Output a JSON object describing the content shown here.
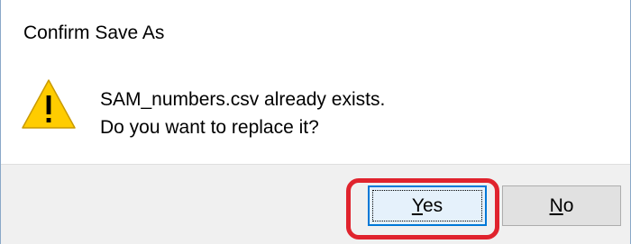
{
  "dialog": {
    "title": "Confirm Save As",
    "icon": "warning-icon",
    "message_line1": "SAM_numbers.csv already exists.",
    "message_line2": "Do you want to replace it?"
  },
  "buttons": {
    "yes": {
      "accel": "Y",
      "rest": "es",
      "focused": true
    },
    "no": {
      "accel": "N",
      "rest": "o",
      "focused": false
    }
  },
  "colors": {
    "accent_focus": "#0078d7",
    "highlight_ring": "#e0232d",
    "warning_yellow": "#ffcc00",
    "button_bar_bg": "#f0f0f0"
  }
}
